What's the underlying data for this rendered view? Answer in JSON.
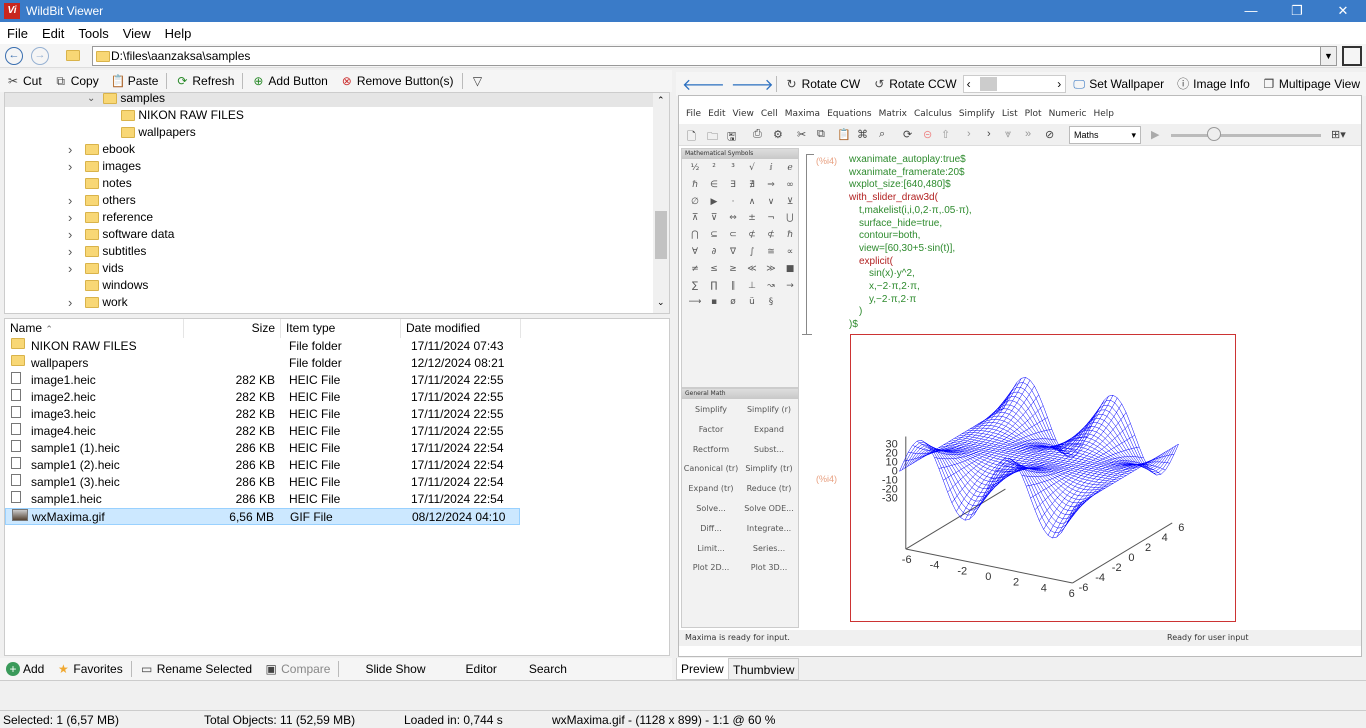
{
  "window": {
    "title": "WildBit Viewer",
    "logo": "Vi",
    "controls": [
      "minimize",
      "maximize",
      "close"
    ]
  },
  "menu": [
    "File",
    "Edit",
    "Tools",
    "View",
    "Help"
  ],
  "address": {
    "path": "D:\\files\\aanzaksa\\samples"
  },
  "left_toolbar": [
    {
      "label": "Cut",
      "icon": "scissors-icon"
    },
    {
      "label": "Copy",
      "icon": "copy-icon"
    },
    {
      "label": "Paste",
      "icon": "paste-icon"
    },
    {
      "label": "Refresh",
      "icon": "refresh-icon"
    },
    {
      "label": "Add Button",
      "icon": "add-button-icon"
    },
    {
      "label": "Remove Button(s)",
      "icon": "remove-button-icon"
    }
  ],
  "tree": {
    "expanded": "samples",
    "children": [
      "NIKON RAW FILES",
      "wallpapers"
    ],
    "siblings": [
      {
        "label": "ebook",
        "expandable": true
      },
      {
        "label": "images",
        "expandable": true
      },
      {
        "label": "notes",
        "expandable": false
      },
      {
        "label": "others",
        "expandable": true
      },
      {
        "label": "reference",
        "expandable": true
      },
      {
        "label": "software data",
        "expandable": true
      },
      {
        "label": "subtitles",
        "expandable": true
      },
      {
        "label": "vids",
        "expandable": true
      },
      {
        "label": "windows",
        "expandable": false
      },
      {
        "label": "work",
        "expandable": true
      }
    ]
  },
  "file_list": {
    "columns": [
      "Name",
      "Size",
      "Item type",
      "Date modified"
    ],
    "sort_column": "Name",
    "rows": [
      {
        "name": "NIKON RAW FILES",
        "size": "",
        "type": "File folder",
        "date": "17/11/2024 07:43",
        "kind": "folder"
      },
      {
        "name": "wallpapers",
        "size": "",
        "type": "File folder",
        "date": "12/12/2024 08:21",
        "kind": "folder"
      },
      {
        "name": "image1.heic",
        "size": "282 KB",
        "type": "HEIC File",
        "date": "17/11/2024 22:55",
        "kind": "file"
      },
      {
        "name": "image2.heic",
        "size": "282 KB",
        "type": "HEIC File",
        "date": "17/11/2024 22:55",
        "kind": "file"
      },
      {
        "name": "image3.heic",
        "size": "282 KB",
        "type": "HEIC File",
        "date": "17/11/2024 22:55",
        "kind": "file"
      },
      {
        "name": "image4.heic",
        "size": "282 KB",
        "type": "HEIC File",
        "date": "17/11/2024 22:55",
        "kind": "file"
      },
      {
        "name": "sample1 (1).heic",
        "size": "286 KB",
        "type": "HEIC File",
        "date": "17/11/2024 22:54",
        "kind": "file"
      },
      {
        "name": "sample1 (2).heic",
        "size": "286 KB",
        "type": "HEIC File",
        "date": "17/11/2024 22:54",
        "kind": "file"
      },
      {
        "name": "sample1 (3).heic",
        "size": "286 KB",
        "type": "HEIC File",
        "date": "17/11/2024 22:54",
        "kind": "file"
      },
      {
        "name": "sample1.heic",
        "size": "286 KB",
        "type": "HEIC File",
        "date": "17/11/2024 22:54",
        "kind": "file"
      },
      {
        "name": "wxMaxima.gif",
        "size": "6,56 MB",
        "type": "GIF File",
        "date": "08/12/2024 04:10",
        "kind": "image",
        "selected": true
      }
    ]
  },
  "bottom_toolbar": [
    "Add",
    "Favorites",
    "Rename Selected",
    "Compare",
    "Slide Show",
    "Editor",
    "Search"
  ],
  "status": {
    "selected": "Selected: 1 (6,57 MB)",
    "total": "Total Objects: 11 (52,59 MB)",
    "loaded": "Loaded in: 0,744 s",
    "image": "wxMaxima.gif -  (1128 x 899) - 1:1 @ 60  %"
  },
  "right_toolbar": [
    "Rotate CW",
    "Rotate CCW",
    "Set Wallpaper",
    "Image Info",
    "Multipage View"
  ],
  "preview_tabs": [
    {
      "label": "Preview",
      "active": true
    },
    {
      "label": "Thumbview",
      "active": false
    }
  ],
  "wxmaxima": {
    "menu": [
      "File",
      "Edit",
      "View",
      "Cell",
      "Maxima",
      "Equations",
      "Matrix",
      "Calculus",
      "Simplify",
      "List",
      "Plot",
      "Numeric",
      "Help"
    ],
    "mode": "Maths",
    "symbols_title": "Mathematical Symbols",
    "symbols": [
      "½",
      "²",
      "³",
      "√",
      "ⅈ",
      "ℯ",
      "ℏ",
      "∈",
      "∃",
      "∄",
      "⇒",
      "∞",
      "∅",
      "▶",
      "·",
      "∧",
      "∨",
      "⊻",
      "⊼",
      "⊽",
      "⇔",
      "±",
      "¬",
      "⋃",
      "⋂",
      "⊆",
      "⊂",
      "⊄",
      "⊄",
      "ℏ",
      "∀",
      "∂",
      "∇",
      "∫",
      "≅",
      "∝",
      "≠",
      "≤",
      "≥",
      "≪",
      "≫",
      "■",
      "∑",
      "∏",
      "∥",
      "⊥",
      "↝",
      "→",
      "⟶",
      "▪",
      "ø",
      "ü",
      "§"
    ],
    "general_title": "General Math",
    "general": [
      "Simplify",
      "Simplify (r)",
      "Factor",
      "Expand",
      "Rectform",
      "Subst...",
      "Canonical (tr)",
      "Simplify (tr)",
      "Expand (tr)",
      "Reduce (tr)",
      "Solve...",
      "Solve ODE...",
      "Diff...",
      "Integrate...",
      "Limit...",
      "Series...",
      "Plot 2D...",
      "Plot 3D..."
    ],
    "input_label": "(%i4)",
    "output_label": "(%i4)",
    "code": [
      "wxanimate_autoplay:true$",
      "wxanimate_framerate:20$",
      "wxplot_size:[640,480]$",
      "with_slider_draw3d(",
      "t,makelist(i,i,0,2·π,.05·π),",
      "surface_hide=true,",
      "contour=both,",
      "view=[60,30+5·sin(t)],",
      "explicit(",
      "sin(x)·y^2,",
      "x,−2·π,2·π,",
      "y,−2·π,2·π",
      ")",
      ")$"
    ],
    "status_left": "Maxima is ready for input.",
    "status_right": "Ready for user input",
    "colors": {
      "code": "#2e8b2e",
      "keyword": "#b22222",
      "number": "#d2691e",
      "mesh": "#0000ff",
      "plot_border": "#cc3333"
    }
  },
  "chart_data": {
    "type": "surface3d",
    "function": "sin(x)*y^2",
    "x_range": [
      -6.283,
      6.283
    ],
    "y_range": [
      -6.283,
      6.283
    ],
    "z_ticks": [
      "30",
      "20",
      "10",
      "0",
      "-10",
      "-20",
      "-30"
    ],
    "x_ticks": [
      "-6",
      "-4",
      "-2",
      "0",
      "2",
      "4",
      "6"
    ],
    "y_ticks": [
      "-6",
      "-4",
      "-2",
      "0",
      "2",
      "4",
      "6"
    ],
    "view": [
      60,
      30
    ],
    "contour": "both"
  }
}
